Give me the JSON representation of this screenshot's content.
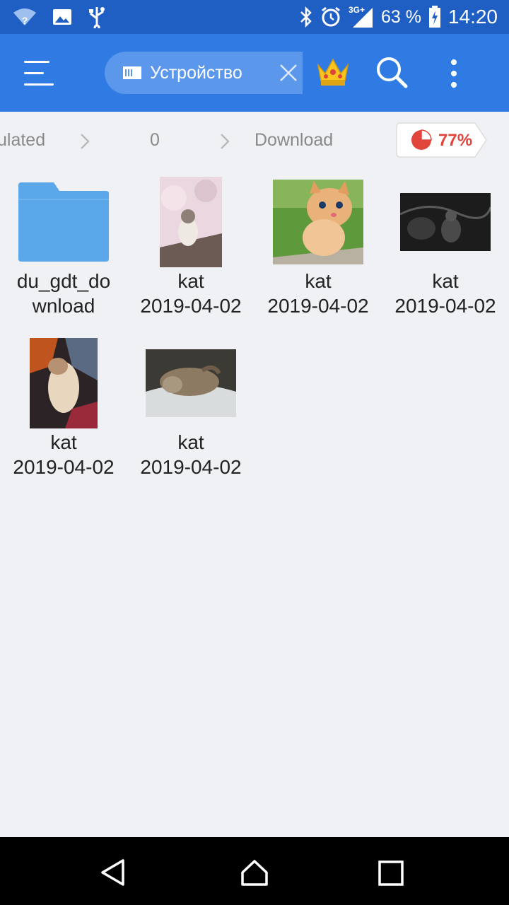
{
  "status_bar": {
    "network_label": "3G+",
    "battery": "63 %",
    "time": "14:20"
  },
  "toolbar": {
    "location_label": "Устройство"
  },
  "breadcrumb": {
    "items": [
      "ulated",
      "0",
      "Download"
    ],
    "storage_usage": "77%"
  },
  "files": [
    {
      "name": "du_gdt_do",
      "name2": "wnload",
      "type": "folder",
      "color": "#5aa7ea"
    },
    {
      "name": "kat",
      "date": "2019-04-02",
      "type": "image",
      "thumb_colors": [
        "#e9d6df",
        "#8a7a72"
      ]
    },
    {
      "name": "kat",
      "date": "2019-04-02",
      "type": "image",
      "thumb_colors": [
        "#5e9a3c",
        "#e9b27a"
      ]
    },
    {
      "name": "kat",
      "date": "2019-04-02",
      "type": "image",
      "thumb_colors": [
        "#1c1c1c",
        "#4a4a4a"
      ]
    },
    {
      "name": "kat",
      "date": "2019-04-02",
      "type": "image",
      "thumb_colors": [
        "#2b2326",
        "#d7b48f"
      ]
    },
    {
      "name": "kat",
      "date": "2019-04-02",
      "type": "image",
      "thumb_colors": [
        "#3b3a34",
        "#a89880"
      ]
    }
  ],
  "colors": {
    "status_bar": "#1f5fc4",
    "toolbar": "#2f7be3",
    "background": "#eff1f4",
    "accent_red": "#e0443a"
  }
}
